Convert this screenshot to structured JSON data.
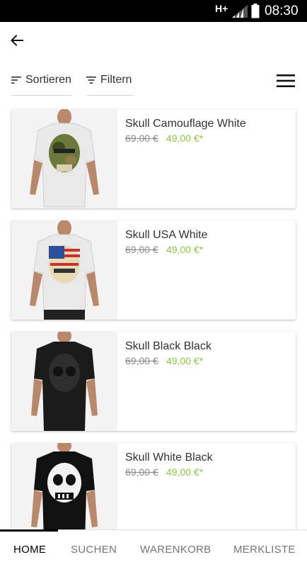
{
  "status_bar": {
    "network": "H+",
    "time": "08:30"
  },
  "toolbar": {
    "sort_label": "Sortieren",
    "filter_label": "Filtern"
  },
  "products": [
    {
      "name": "Skull Camouflage White",
      "old_price": "69,00 €",
      "price": "49,00 €*",
      "shirt_color": "#e9e9e9",
      "print": "camouflage"
    },
    {
      "name": "Skull USA White",
      "old_price": "69,00 €",
      "price": "49,00 €*",
      "shirt_color": "#e9e9e9",
      "print": "usa"
    },
    {
      "name": "Skull Black Black",
      "old_price": "69,00 €",
      "price": "49,00 €*",
      "shirt_color": "#1b1b1b",
      "print": "black"
    },
    {
      "name": "Skull White Black",
      "old_price": "69,00 €",
      "price": "49,00 €*",
      "shirt_color": "#111111",
      "print": "white"
    }
  ],
  "bottom_nav": {
    "items": [
      {
        "label": "HOME",
        "active": true
      },
      {
        "label": "SUCHEN",
        "active": false
      },
      {
        "label": "WARENKORB",
        "active": false
      },
      {
        "label": "MERKLISTE",
        "active": false
      }
    ]
  },
  "colors": {
    "accent_price": "#8dc63f",
    "old_price": "#8a8a8a",
    "status_bar": "#000000"
  }
}
